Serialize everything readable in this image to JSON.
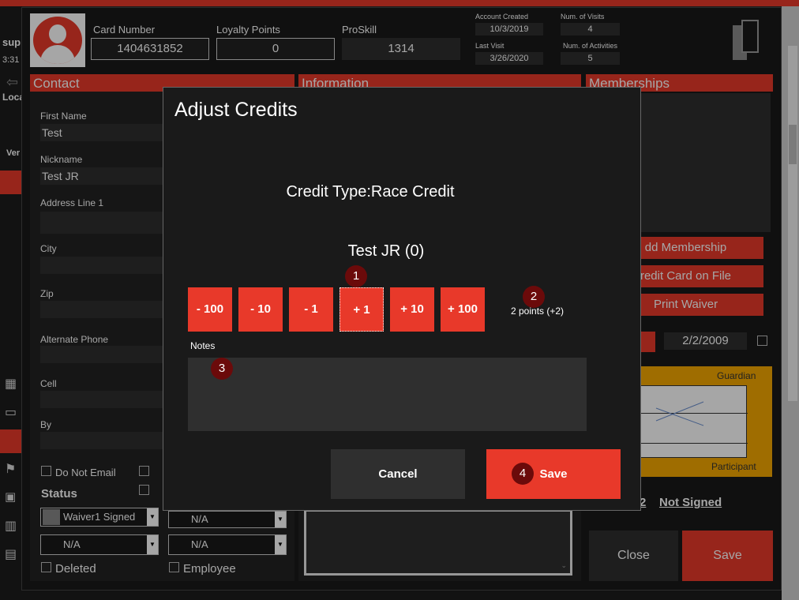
{
  "background_app": {
    "sidebar_texts": [
      "sup",
      "3:31",
      "Loca",
      "Ver"
    ]
  },
  "header": {
    "card_number_label": "Card Number",
    "card_number_value": "1404631852",
    "loyalty_points_label": "Loyalty Points",
    "loyalty_points_value": "0",
    "proskill_label": "ProSkill",
    "proskill_value": "1314",
    "account_created_label": "Account Created",
    "account_created_value": "10/3/2019",
    "num_visits_label": "Num. of Visits",
    "num_visits_value": "4",
    "last_visit_label": "Last Visit",
    "last_visit_value": "3/26/2020",
    "num_activities_label": "Num. of Activities",
    "num_activities_value": "5"
  },
  "contact": {
    "title": "Contact",
    "first_name_label": "First Name",
    "first_name_value": "Test",
    "nickname_label": "Nickname",
    "nickname_value": "Test JR",
    "address_label": "Address Line 1",
    "city_label": "City",
    "zip_label": "Zip",
    "alt_phone_label": "Alternate Phone",
    "cell_label": "Cell",
    "by_label": "By",
    "do_not_email_label": "Do Not Email",
    "status_label": "Status",
    "waiver_select": "Waiver1 Signed",
    "select2": "N/A",
    "select3": "N/A",
    "select4": "N/A",
    "deleted_label": "Deleted",
    "employee_label": "Employee"
  },
  "information": {
    "title": "Information"
  },
  "memberships": {
    "title": "Memberships",
    "add_membership_label": "dd Membership",
    "credit_card_label": "redit Card on File",
    "print_waiver_label": "Print Waiver",
    "date_value": "2/2/2009",
    "guardian_label": "Guardian",
    "participant_label": "Participant",
    "not_signed_label": "Not Signed",
    "close_label": "Close",
    "save_label": "Save"
  },
  "dialog": {
    "title": "Adjust Credits",
    "credit_type": "Credit Type:Race Credit",
    "customer": "Test JR (0)",
    "buttons": [
      "- 100",
      "- 10",
      "- 1",
      "+ 1",
      "+ 10",
      "+ 100"
    ],
    "points_text": "2 points (+2)",
    "notes_label": "Notes",
    "cancel_label": "Cancel",
    "save_label": "Save",
    "badges": [
      "1",
      "2",
      "3",
      "4"
    ]
  }
}
